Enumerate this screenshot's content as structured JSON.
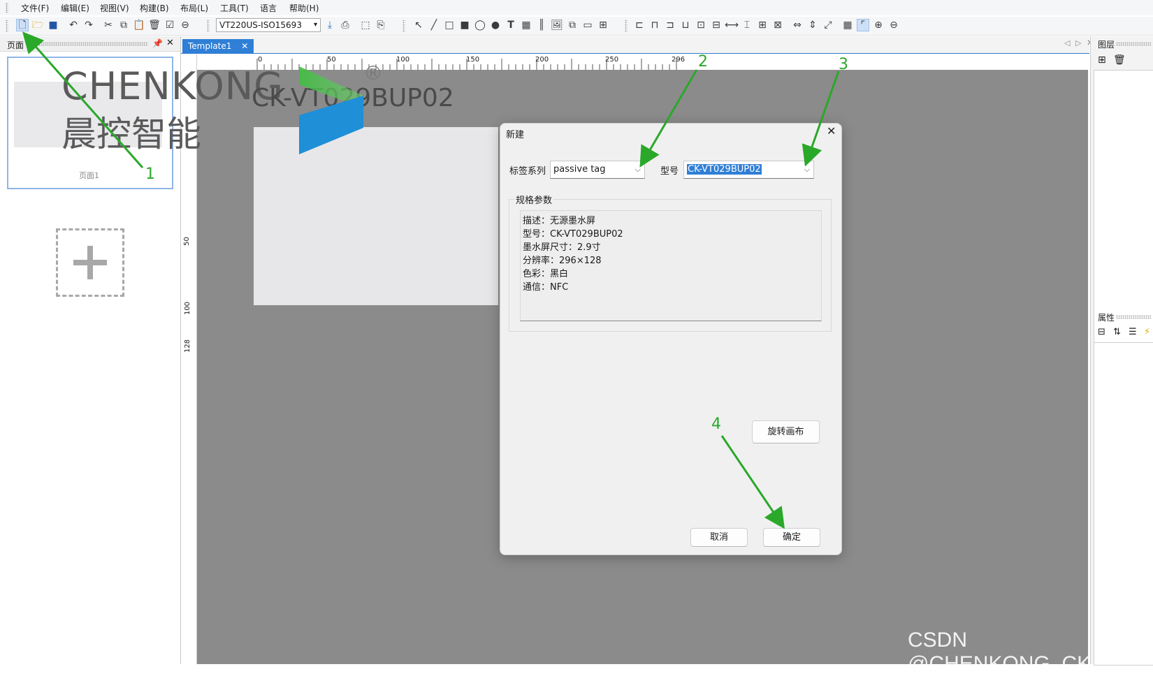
{
  "menu": [
    "文件(F)",
    "编辑(E)",
    "视图(V)",
    "构建(B)",
    "布局(L)",
    "工具(T)",
    "语言",
    "帮助(H)"
  ],
  "toolbar": {
    "printer": "VT220US-ISO15693",
    "icons": [
      "new-file-icon",
      "open-folder-icon",
      "save-icon",
      "undo-icon",
      "redo-icon",
      "cut-icon",
      "copy-icon",
      "paste-icon",
      "delete-icon",
      "check-icon",
      "zoom-out-circle-icon",
      "download-icon",
      "print-icon",
      "image-export-icon",
      "print-preview-icon",
      "pointer-icon",
      "line-icon",
      "rectangle-icon",
      "filled-rectangle-icon",
      "ellipse-icon",
      "filled-ellipse-icon",
      "text-icon",
      "qrcode-icon",
      "barcode-icon",
      "image-icon",
      "copy-image-icon",
      "shape-icon",
      "table-icon",
      "align-left-icon",
      "align-top-icon",
      "align-right-icon",
      "align-bottom-icon",
      "center-h-icon",
      "center-v-icon",
      "distribute-h-icon",
      "distribute-v-icon",
      "group-icon",
      "ungroup-icon",
      "same-width-icon",
      "same-height-icon",
      "same-size-icon",
      "grid-icon",
      "snap-icon",
      "zoom-in-icon",
      "zoom-out-icon"
    ]
  },
  "left_panel": {
    "title": "页面",
    "page_label": "页面1"
  },
  "doc_tab": {
    "label": "Template1"
  },
  "ruler": {
    "top_ticks": [
      "0",
      "50",
      "100",
      "150",
      "200",
      "250",
      "296"
    ],
    "left_ticks": [
      "50",
      "100",
      "128"
    ]
  },
  "logo": {
    "brand_en": "CHENKONG",
    "brand_cn": "晨控智能",
    "registered": "®",
    "overlay_model": "CK-VT029BUP02",
    "colors": {
      "green": "#3fbf3f",
      "blue": "#1f8fd8"
    }
  },
  "right_panel": {
    "layers_title": "图层",
    "props_title": "属性"
  },
  "dialog": {
    "title": "新建",
    "series_label": "标签系列",
    "series_value": "passive tag",
    "model_label": "型号",
    "model_value": "CK-VT029BUP02",
    "specs_group_label": "规格参数",
    "specs": [
      "描述：无源墨水屏",
      "型号：CK-VT029BUP02",
      "墨水屏尺寸：2.9寸",
      "分辨率：296×128",
      "色彩：黑白",
      "通信：NFC"
    ],
    "rotate_button": "旋转画布",
    "cancel_button": "取消",
    "ok_button": "确定"
  },
  "annotations": [
    "1",
    "2",
    "3",
    "4"
  ],
  "watermark": "CSDN @CHENKONG_CK",
  "colors": {
    "accent": "#2f7fd6",
    "arrow": "#2aa82a",
    "canvas": "#8b8b8b"
  }
}
